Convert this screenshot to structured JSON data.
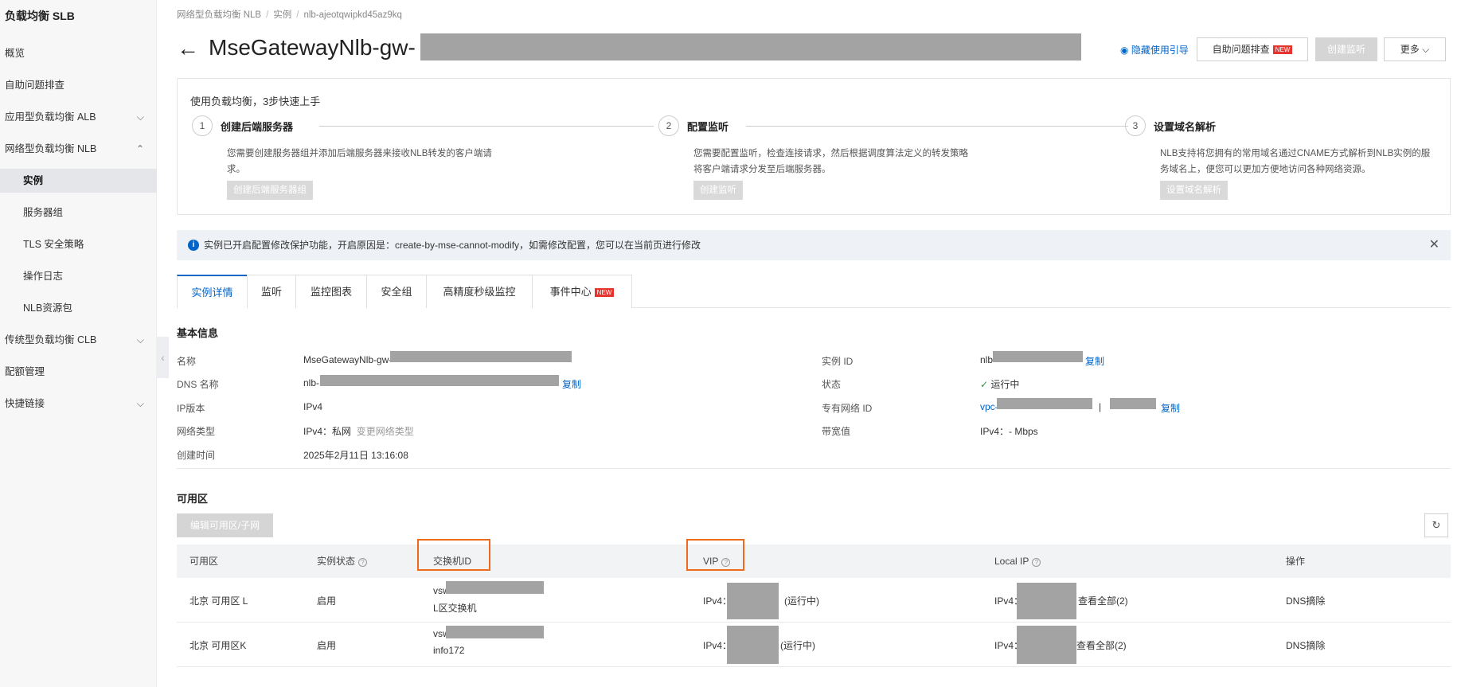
{
  "sidebar": {
    "title": "负载均衡 SLB",
    "items": [
      {
        "label": "概览"
      },
      {
        "label": "自助问题排查"
      },
      {
        "label": "应用型负载均衡 ALB"
      },
      {
        "label": "网络型负载均衡 NLB"
      },
      {
        "label": "实例"
      },
      {
        "label": "服务器组"
      },
      {
        "label": "TLS 安全策略"
      },
      {
        "label": "操作日志"
      },
      {
        "label": "NLB资源包"
      },
      {
        "label": "传统型负载均衡 CLB"
      },
      {
        "label": "配额管理"
      },
      {
        "label": "快捷链接"
      }
    ]
  },
  "breadcrumb": [
    "网络型负载均衡 NLB",
    "实例",
    "nlb-ajeotqwipkd45az9kq"
  ],
  "header": {
    "title": "MseGatewayNlb-gw-",
    "guide_link": "隐藏使用引导",
    "self_check": "自助问题排查",
    "new": "NEW",
    "create_listener": "创建监听",
    "more": "更多"
  },
  "guide": {
    "heading": "使用负载均衡，3步快速上手",
    "steps": [
      {
        "num": "1",
        "title": "创建后端服务器",
        "desc": "您需要创建服务器组并添加后端服务器来接收NLB转发的客户端请求。",
        "button": "创建后端服务器组"
      },
      {
        "num": "2",
        "title": "配置监听",
        "desc": "您需要配置监听，检查连接请求，然后根据调度算法定义的转发策略将客户端请求分发至后端服务器。",
        "button": "创建监听"
      },
      {
        "num": "3",
        "title": "设置域名解析",
        "desc": "NLB支持将您拥有的常用域名通过CNAME方式解析到NLB实例的服务域名上，便您可以更加方便地访问各种网络资源。",
        "button": "设置域名解析"
      }
    ]
  },
  "notice": {
    "text": "实例已开启配置修改保护功能，开启原因是：create-by-mse-cannot-modify，如需修改配置，您可以在当前页进行修改"
  },
  "tabs": [
    {
      "label": "实例详情"
    },
    {
      "label": "监听"
    },
    {
      "label": "监控图表"
    },
    {
      "label": "安全组"
    },
    {
      "label": "高精度秒级监控"
    },
    {
      "label": "事件中心"
    }
  ],
  "basic": {
    "title": "基本信息",
    "name_label": "名称",
    "name_value": "MseGatewayNlb-gw-",
    "dns_label": "DNS 名称",
    "dns_value": "nlb-",
    "copy": "复制",
    "ipver_label": "IP版本",
    "ipver_value": "IPv4",
    "nettype_label": "网络类型",
    "nettype_value": "IPv4：私网",
    "nettype_change": "变更网络类型",
    "created_label": "创建时间",
    "created_value": "2025年2月11日 13:16:08",
    "id_label": "实例 ID",
    "id_value": "nlb-",
    "status_label": "状态",
    "status_value": "运行中",
    "vpc_label": "专有网络 ID",
    "vpc_value": "vpc-",
    "vpc_sep": "|",
    "bw_label": "带宽值",
    "bw_value": "IPv4：- Mbps"
  },
  "zones": {
    "title": "可用区",
    "edit_button": "编辑可用区/子网",
    "columns": [
      "可用区",
      "实例状态",
      "交换机ID",
      "VIP",
      "Local IP",
      "操作"
    ],
    "rows": [
      {
        "zone": "北京 可用区 L",
        "state": "启用",
        "vsw": "vsw-",
        "vsw_name": "L区交换机",
        "vip_prefix": "IPv4：",
        "vip_status": "(运行中)",
        "lip_prefix": "IPv4：",
        "lip_link": "查看全部(2)",
        "action": "DNS摘除"
      },
      {
        "zone": "北京 可用区K",
        "state": "启用",
        "vsw": "vsw-",
        "vsw_name": "info172",
        "vip_prefix": "IPv4：",
        "vip_status": "(运行中)",
        "lip_prefix": "IPv4：",
        "lip_link": "查看全部(2)",
        "action": "DNS摘除"
      }
    ]
  }
}
